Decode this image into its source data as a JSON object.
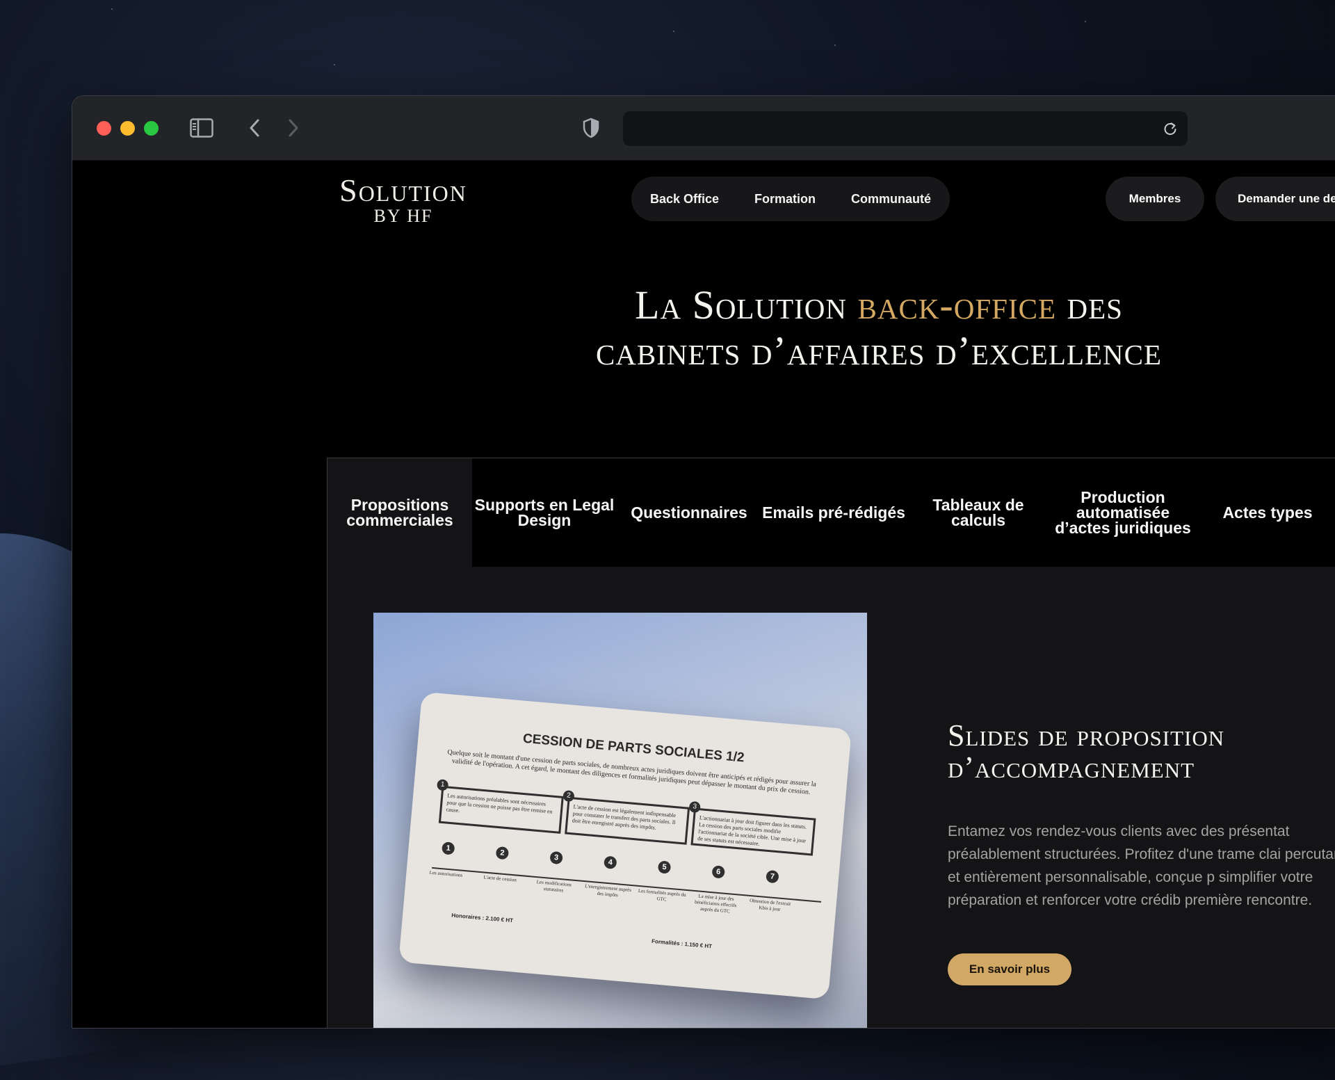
{
  "brand": {
    "name": "Solution",
    "sub": "BY HF"
  },
  "nav": {
    "items": [
      "Back Office",
      "Formation",
      "Communauté"
    ]
  },
  "header_buttons": {
    "members": "Membres",
    "demo": "Demander une de"
  },
  "hero": {
    "prefix": "La Solution",
    "highlight": "back-office",
    "suffix": "des",
    "line2": "cabinets d’affaires d’excellence",
    "highlight_color": "#d5a962"
  },
  "tabs": [
    "Propositions commerciales",
    "Supports en Legal Design",
    "Questionnaires",
    "Emails pré-rédigés",
    "Tableaux de calculs",
    "Production automatisée d’actes juridiques",
    "Actes types"
  ],
  "feature": {
    "title": "Slides de proposition d’accompagnement",
    "text": "Entamez vos rendez-vous clients avec des présentat préalablement structurées. Profitez d'une trame clai percutante et entièrement personnalisable, conçue p simplifier votre préparation et renforcer votre crédib première rencontre.",
    "cta": "En savoir plus",
    "cta_color": "#d2a866"
  },
  "slide": {
    "title": "CESSION DE PARTS SOCIALES 1/2",
    "intro": "Quelque soit le montant d'une cession de parts sociales, de nombreux actes juridiques doivent être anticipés et rédigés pour assurer la validité de l'opération. A cet égard, le montant des diligences et formalités juridiques peut dépasser le montant du prix de cession.",
    "boxes": [
      {
        "num": "1",
        "text": "Les autorisations préalables sont nécessaires pour que la cession ne puisse pas être remise en cause."
      },
      {
        "num": "2",
        "text": "L'acte de cession est légalement indispensable pour constater le transfert des parts sociales. Il doit être enregistré auprès des impôts."
      },
      {
        "num": "3",
        "text": "L'actionnariat à jour doit figurer dans les statuts. La cession des parts sociales modifie l'actionnariat de la société cible. Une mise à jour de ses statuts est nécessaire."
      }
    ],
    "steps": [
      {
        "num": "1",
        "label": "Les autorisations"
      },
      {
        "num": "2",
        "label": "L'acte de cession"
      },
      {
        "num": "3",
        "label": "Les modifications statutaires"
      },
      {
        "num": "4",
        "label": "L'enregistrement auprès des impôts"
      },
      {
        "num": "5",
        "label": "Les formalités auprès du GTC"
      },
      {
        "num": "6",
        "label": "La mise à jour des bénéficiaires effectifs auprès du GTC"
      },
      {
        "num": "7",
        "label": "Obtention de l'extrait Kbis à jour"
      }
    ],
    "fees": {
      "honoraires": "Honoraires : 2.100 € HT",
      "formalites": "Formalités : 1.150 € HT"
    }
  }
}
